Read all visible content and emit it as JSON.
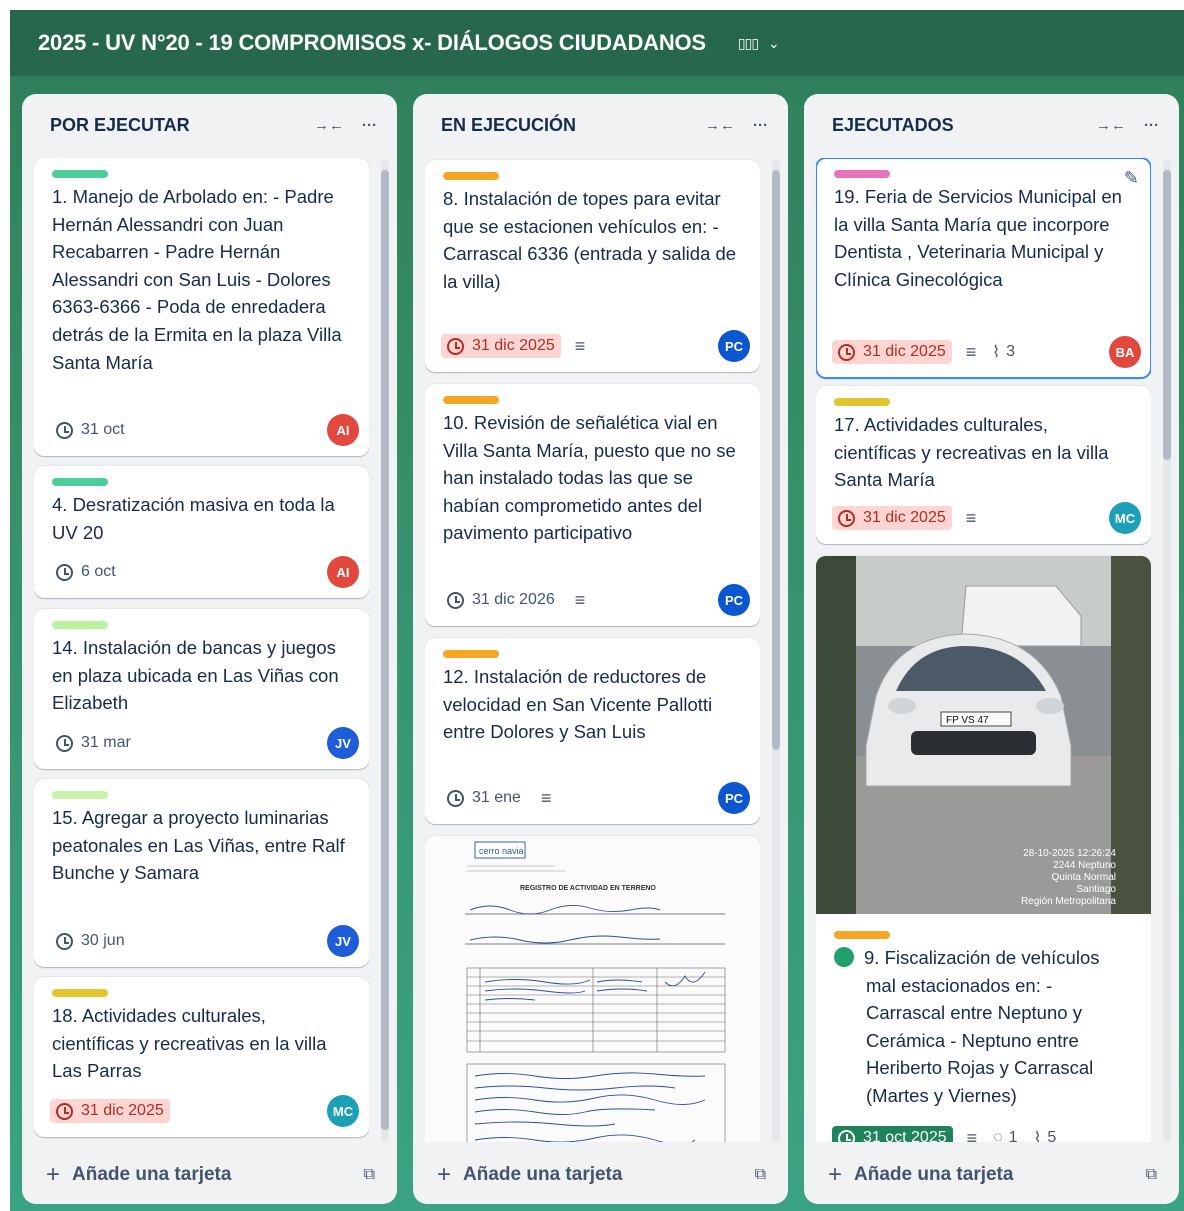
{
  "board": {
    "title": "2025 - UV N°20 - 19 COMPROMISOS x- DIÁLOGOS CIUDADANOS",
    "view_icon": "board-view-icon"
  },
  "lists": [
    {
      "title": "POR EJECUTAR",
      "add_label": "Añade una tarjeta",
      "cards": [
        {
          "label_color": "#4bce97",
          "title": "1. Manejo de Arbolado en: - Padre Hernán Alessandri con Juan Recabarren - Padre Hernán Alessandri con San Luis - Dolores 6363-6366 - Poda de enredadera detrás de la Ermita en la plaza Villa Santa María",
          "due": "31 oct",
          "avatar": "AI",
          "avatar_color": "#e2483d"
        },
        {
          "label_color": "#4bce97",
          "title": "4. Desratización masiva en toda la UV 20",
          "due": "6 oct",
          "avatar": "AI",
          "avatar_color": "#e2483d"
        },
        {
          "label_color": "#baf3a0",
          "title": "14. Instalación de bancas y juegos en plaza ubicada en Las Viñas con Elizabeth",
          "due": "31 mar",
          "avatar": "JV",
          "avatar_color": "#1d5ed8"
        },
        {
          "label_color": "#c8f3a8",
          "title": "15. Agregar a proyecto luminarias peatonales en Las Viñas, entre Ralf Bunche y Samara",
          "due": "30 jun",
          "avatar": "JV",
          "avatar_color": "#1d5ed8"
        },
        {
          "label_color": "#e2c42c",
          "title": "18. Actividades culturales, científicas y recreativas en la villa Las Parras",
          "due": "31 dic 2025",
          "avatar": "MC",
          "avatar_color": "#1ba0b8"
        }
      ]
    },
    {
      "title": "EN EJECUCIÓN",
      "add_label": "Añade una tarjeta",
      "cards": [
        {
          "label_color": "#f5a623",
          "title": "8. Instalación de topes para evitar que se estacionen vehículos en: - Carrascal 6336 (entrada y salida de la villa)",
          "due": "31 dic 2025",
          "avatar": "PC",
          "avatar_color": "#0c56d0"
        },
        {
          "label_color": "#f5a623",
          "title": "10. Revisión de señalética vial en Villa Santa María, puesto que no se han instalado todas las que se habían comprometido antes del pavimento participativo",
          "due": "31 dic 2026",
          "avatar": "PC",
          "avatar_color": "#0c56d0"
        },
        {
          "label_color": "#f5a623",
          "title": "12. Instalación de reductores de velocidad en San Vicente Pallotti entre Dolores y San Luis",
          "due": "31 ene",
          "avatar": "PC",
          "avatar_color": "#0c56d0"
        }
      ],
      "doc_card": {
        "heading": "REGISTRO DE ACTIVIDAD EN TERRENO",
        "logo": "cerro navia"
      }
    },
    {
      "title": "EJECUTADOS",
      "add_label": "Añade una tarjeta",
      "cards": [
        {
          "label_color": "#e774bb",
          "title": "19. Feria de Servicios Municipal en la villa Santa María que incorpore Dentista , Veterinaria Municipal y Clínica Ginecológica",
          "due": "31 dic 2025",
          "attachments": "3",
          "avatar": "BA",
          "avatar_color": "#e2483d"
        },
        {
          "label_color": "#e2c42c",
          "title": "17. Actividades culturales, científicas y recreativas en la villa Santa María",
          "due": "31 dic 2025",
          "avatar": "MC",
          "avatar_color": "#1ba0b8"
        },
        {
          "label_color": "#f5a623",
          "title": "9. Fiscalización de vehículos mal estacionados en: - Carrascal entre Neptuno y Cerámica - Neptuno entre Heriberto Rojas y Carrascal (Martes y Viernes)",
          "due": "31 oct 2025",
          "comments": "1",
          "attachments": "5"
        }
      ],
      "photo": {
        "plate": "FP VS 47",
        "stamp": [
          "28-10-2025 12:26:24",
          "2244 Neptuno",
          "Quinta Normal",
          "Santiago",
          "Región Metropolitana"
        ]
      }
    }
  ]
}
